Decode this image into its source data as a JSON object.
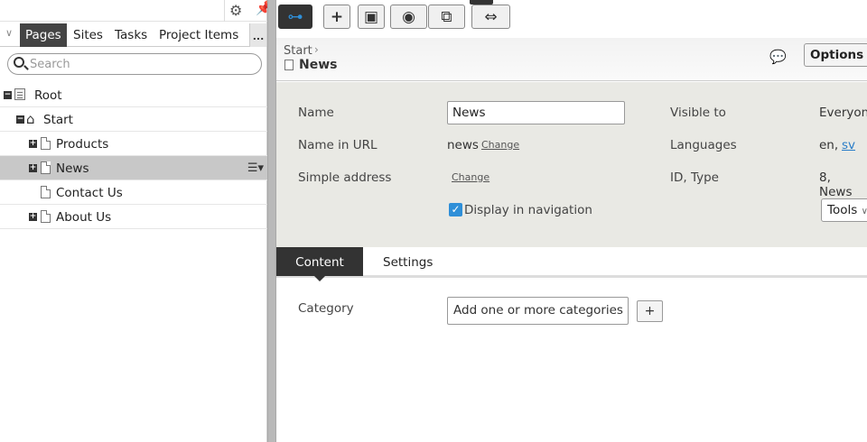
{
  "left_pane": {
    "tabs": [
      "Pages",
      "Sites",
      "Tasks",
      "Project Items"
    ],
    "more_label": "...",
    "search_placeholder": "Search",
    "tree": [
      {
        "label": "Root",
        "level": 0,
        "toggle": "-",
        "icon": "root-icon"
      },
      {
        "label": "Start",
        "level": 1,
        "toggle": "-",
        "icon": "home-icon"
      },
      {
        "label": "Products",
        "level": 2,
        "toggle": "+",
        "icon": "page-icon"
      },
      {
        "label": "News",
        "level": 2,
        "toggle": "+",
        "icon": "page-icon",
        "selected": true
      },
      {
        "label": "Contact Us",
        "level": 2,
        "toggle": "",
        "icon": "page-icon"
      },
      {
        "label": "About Us",
        "level": 2,
        "toggle": "+",
        "icon": "page-icon"
      }
    ]
  },
  "header": {
    "breadcrumb": "Start",
    "page_title": "News",
    "options_label": "Options"
  },
  "properties": {
    "name_label": "Name",
    "name_value": "News",
    "url_label": "Name in URL",
    "url_value": "news",
    "change_label": "Change",
    "simple_label": "Simple address",
    "display_nav_label": "Display in navigation",
    "visible_label": "Visible to",
    "visible_value": "Everyon",
    "languages_label": "Languages",
    "languages_value": "en,",
    "languages_link": "sv",
    "id_label": "ID, Type",
    "id_value": "8, News",
    "tools_label": "Tools"
  },
  "content_tabs": [
    "Content",
    "Settings"
  ],
  "content": {
    "category_label": "Category",
    "category_button": "Add one or more categories",
    "add_label": "+"
  },
  "colors": {
    "accent": "#2f8fd8",
    "active_tab": "#444444",
    "props_bg": "#e9e9e4"
  }
}
